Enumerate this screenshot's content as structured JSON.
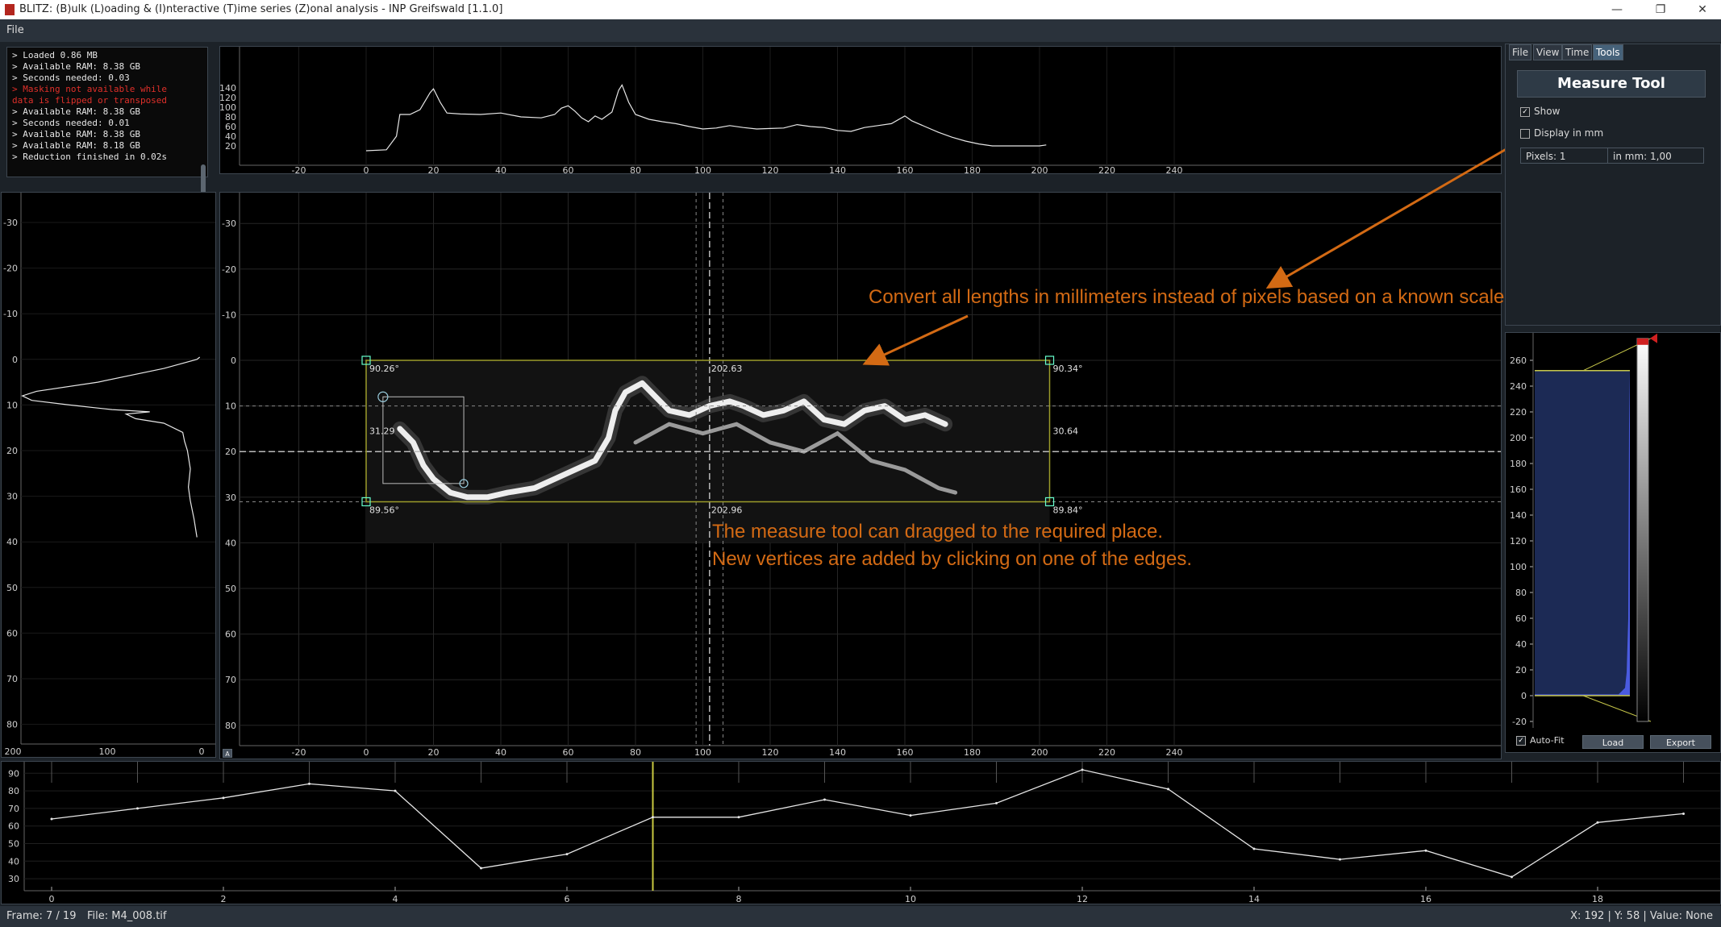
{
  "window": {
    "title": "BLITZ: (B)ulk (L)oading & (I)nteractive (T)ime series (Z)onal analysis - INP Greifswald [1.1.0]",
    "minimize_glyph": "—",
    "maximize_glyph": "❐",
    "close_glyph": "✕"
  },
  "menu": {
    "file": "File"
  },
  "log": {
    "lines": [
      {
        "text": "> Loaded 0.86 MB",
        "error": false
      },
      {
        "text": "> Available RAM: 8.38 GB",
        "error": false
      },
      {
        "text": "> Seconds needed: 0.03",
        "error": false
      },
      {
        "text": "> Masking not available while",
        "error": true
      },
      {
        "text": "data is flipped or transposed",
        "error": true
      },
      {
        "text": "> Available RAM: 8.38 GB",
        "error": false
      },
      {
        "text": "> Seconds needed: 0.01",
        "error": false
      },
      {
        "text": "> Available RAM: 8.38 GB",
        "error": false
      },
      {
        "text": "> Available RAM: 8.18 GB",
        "error": false
      },
      {
        "text": "> Reduction finished in 0.02s",
        "error": false
      }
    ]
  },
  "top_plot": {
    "x_ticks": [
      "-20",
      "0",
      "20",
      "40",
      "60",
      "80",
      "100",
      "120",
      "140",
      "160",
      "180",
      "200",
      "220",
      "240"
    ],
    "y_ticks": [
      "140",
      "120",
      "100",
      "80",
      "60",
      "40",
      "20"
    ]
  },
  "left_plot": {
    "y_ticks": [
      "-30",
      "-20",
      "-10",
      "0",
      "10",
      "20",
      "30",
      "40",
      "50",
      "60",
      "70",
      "80"
    ],
    "x_ticks": [
      "200",
      "100",
      "0"
    ]
  },
  "image_view": {
    "x_ticks": [
      "-20",
      "0",
      "20",
      "40",
      "60",
      "80",
      "100",
      "120",
      "140",
      "160",
      "180",
      "200",
      "220",
      "240"
    ],
    "y_ticks": [
      "-30",
      "-20",
      "-10",
      "0",
      "10",
      "20",
      "30",
      "40",
      "50",
      "60",
      "70",
      "80"
    ],
    "autorange_button": "A",
    "measure": {
      "angle_top_left": "90.26°",
      "angle_top_right": "90.34°",
      "angle_bottom_left": "89.56°",
      "angle_bottom_right": "89.84°",
      "length_top": "202.63",
      "length_bottom": "202.96",
      "length_left": "31.29",
      "length_right": "30.64"
    }
  },
  "annotations": {
    "scale_note": "Convert all lengths in millimeters instead of pixels based on a known scale.",
    "drag_note_line1": "The measure tool can dragged to the required place.",
    "drag_note_line2": "New vertices are added by clicking on one of the edges."
  },
  "right_panel": {
    "tabs": [
      "File",
      "View",
      "Time",
      "Tools"
    ],
    "active_tab": "Tools",
    "header": "Measure Tool",
    "show_label": "Show",
    "show_checked": true,
    "display_mm_label": "Display in mm",
    "display_mm_checked": false,
    "pixels_value": "Pixels: 1",
    "mm_value": "in mm: 1,00"
  },
  "histogram": {
    "y_ticks": [
      "260",
      "240",
      "220",
      "200",
      "180",
      "160",
      "140",
      "120",
      "100",
      "80",
      "60",
      "40",
      "20",
      "0",
      "-20"
    ],
    "autofit_label": "Auto-Fit",
    "autofit_checked": true,
    "load_label": "Load",
    "export_label": "Export"
  },
  "timeline": {
    "y_ticks": [
      "90",
      "80",
      "70",
      "60",
      "50",
      "40",
      "30"
    ],
    "x_ticks": [
      "0",
      "2",
      "4",
      "6",
      "8",
      "10",
      "12",
      "14",
      "16",
      "18"
    ],
    "current_frame_index": 7
  },
  "status": {
    "frame": "Frame: 7 / 19",
    "file": "File: M4_008.tif",
    "cursor": "X: 192 | Y: 58 | Value: None"
  },
  "chart_data": [
    {
      "type": "line",
      "x": [
        0,
        1,
        2,
        3,
        4,
        5,
        6,
        7,
        8,
        9,
        10,
        11,
        12,
        13,
        14,
        15,
        16,
        17,
        18,
        19
      ],
      "values": [
        64,
        70,
        76,
        84,
        80,
        36,
        44,
        65,
        65,
        75,
        66,
        73,
        92,
        81,
        47,
        41,
        46,
        31,
        62,
        67
      ],
      "ylim": [
        25,
        95
      ],
      "xlim": [
        0,
        19
      ]
    }
  ]
}
